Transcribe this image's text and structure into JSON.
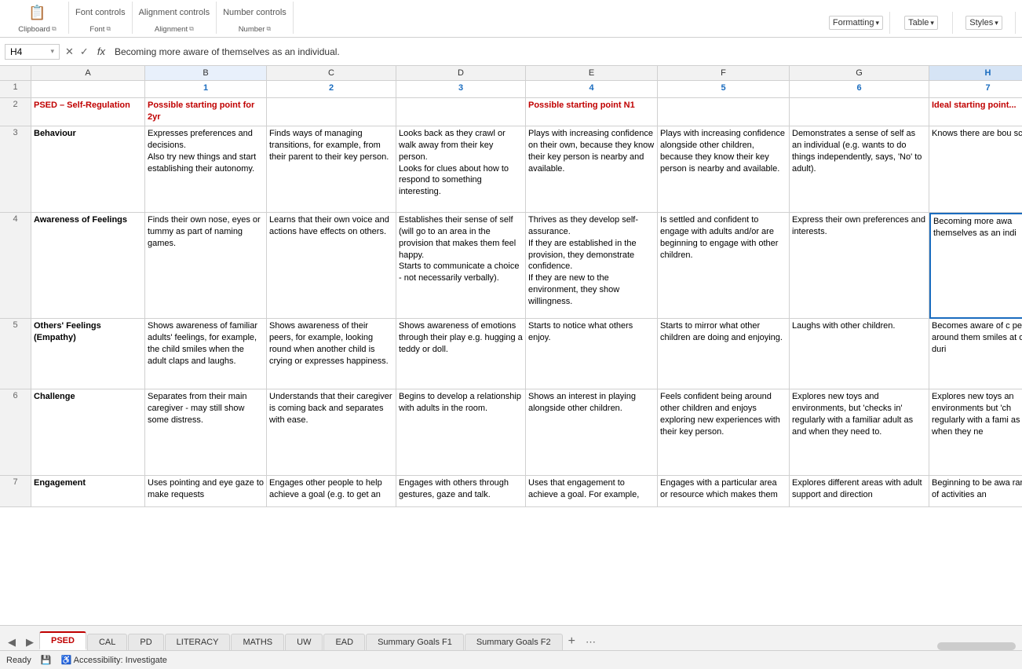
{
  "ribbon": {
    "groups": [
      {
        "label": "Clipboard",
        "expander": true
      },
      {
        "label": "Font",
        "expander": true
      },
      {
        "label": "Alignment",
        "expander": true
      },
      {
        "label": "Number",
        "expander": true
      }
    ],
    "right_groups": [
      {
        "label": "Formatting",
        "dropdown": true
      },
      {
        "label": "Table",
        "dropdown": true
      },
      {
        "label": "Styles",
        "dropdown": true
      }
    ]
  },
  "formula_bar": {
    "cell_ref": "H4",
    "formula": "Becoming more aware of themselves as an individual."
  },
  "columns": {
    "labels": [
      "A",
      "B",
      "C",
      "D",
      "E",
      "F",
      "G",
      "H"
    ],
    "numbers": [
      "",
      "1",
      "2",
      "3",
      "4",
      "5",
      "6",
      "7"
    ]
  },
  "rows": {
    "row1": {
      "num": "1",
      "cells": [
        "",
        "1",
        "2",
        "3",
        "4",
        "5",
        "6",
        "7"
      ]
    },
    "row2": {
      "num": "2",
      "cells": [
        "PSED – Self-Regulation",
        "Possible starting point for 2yr",
        "",
        "",
        "Possible starting point N1",
        "",
        "",
        "Ideal starting point..."
      ]
    },
    "row3": {
      "num": "3",
      "behaviour_label": "Behaviour",
      "cells": [
        "Behaviour",
        "Expresses preferences and decisions.\nAlso try new things and start establishing their autonomy.",
        "Finds ways of managing transitions, for example, from their parent to their key person.",
        "Looks back as they crawl or walk away from their key person.\nLooks for clues about how to respond to something interesting.",
        "Plays with increasing confidence on their own, because they know their key person is nearby and available.",
        "Plays with increasing confidence alongside other children, because they know their key person is nearby and available.",
        "Demonstrates a sense of self as an individual (e.g. wants to do things independently, says, 'No' to adult).",
        "Knows there are bou school."
      ]
    },
    "row4": {
      "num": "4",
      "cells": [
        "Awareness of Feelings",
        "Finds their own nose, eyes or tummy as part of naming games.",
        "Learns that their own voice and actions have effects on others.",
        "Establishes their sense of self (will go to an area in the provision that makes them feel happy.\nStarts to communicate a choice - not necessarily verbally).",
        "Thrives as they develop self-assurance.\nIf they are established in the provision, they demonstrate confidence.\nIf they are new to the environment, they show willingness.",
        "Is settled and confident to engage with adults and/or are beginning to engage with other children.",
        "Express their own preferences and interests.",
        "Becoming more awa themselves as an indi"
      ]
    },
    "row5": {
      "num": "5",
      "cells": [
        "Others' Feelings (Empathy)",
        "Shows awareness of familiar adults' feelings, for example, the child smiles when the adult claps and laughs.",
        "Shows awareness of their peers, for example, looking round when another child is crying or expresses happiness.",
        "Shows awareness of emotions through their play e.g. hugging a teddy or doll.",
        "Starts to notice what others enjoy.",
        "Starts to mirror what other children are doing and enjoying.",
        "Laughs with other children.",
        "Becomes aware of c people around them smiles at others duri"
      ]
    },
    "row6": {
      "num": "6",
      "cells": [
        "Challenge",
        "Separates from their main caregiver - may still show some distress.",
        "Understands that their caregiver is coming back and separates with ease.",
        "Begins to develop a relationship with adults in the room.",
        "Shows an interest in playing alongside other children.",
        "Feels confident being around other children and enjoys exploring new experiences with their key person.",
        "Explores new toys and environments, but 'checks in' regularly with a familiar adult as and when they need to.",
        "Explores new toys an environments but 'ch regularly with a fami as and when they ne"
      ]
    },
    "row7": {
      "num": "7",
      "cells": [
        "Engagement",
        "Uses pointing and eye gaze to make requests",
        "Engages other people to help achieve a goal (e.g. to get an",
        "Engages with others through gestures, gaze and talk.",
        "Uses that engagement to achieve a goal. For example,",
        "Engages with a particular area or resource which makes them",
        "Explores different areas with adult support and direction",
        "Beginning to be awa range of activities an"
      ]
    }
  },
  "tabs": {
    "sheets": [
      "PSED",
      "CAL",
      "PD",
      "LITERACY",
      "MATHS",
      "UW",
      "EAD",
      "Summary Goals F1",
      "Summary Goals F2"
    ],
    "active": "PSED"
  },
  "status": {
    "ready": "Ready",
    "accessibility": "Accessibility: Investigate"
  }
}
